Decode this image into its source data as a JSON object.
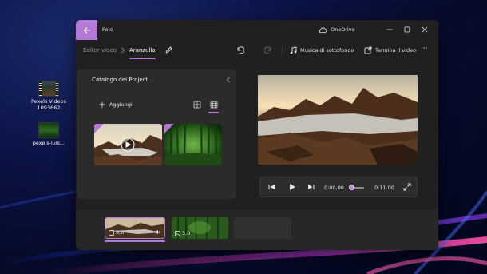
{
  "desktop": {
    "icons": [
      {
        "label_line1": "Pexels Videos",
        "label_line2": "1093662"
      },
      {
        "label_line1": "pexels-luis...",
        "label_line2": ""
      }
    ]
  },
  "window": {
    "app_title": "Foto",
    "cloud_label": "OneDrive",
    "back_icon": "back-arrow-icon"
  },
  "toolbar": {
    "breadcrumb_parent": "Editor video",
    "breadcrumb_current": "Aranzulla",
    "music_label": "Musica di sottofondo",
    "finish_label": "Termina il video",
    "more_label": "···"
  },
  "project_library": {
    "title": "Catalogo del Project",
    "add_label": "Aggiungi"
  },
  "player": {
    "current_time": "0:00,00",
    "total_time": "0:11,00",
    "progress_fraction": 0.0
  },
  "storyboard": {
    "clips": [
      {
        "duration": "8,0",
        "selected": true
      },
      {
        "duration": "3,0",
        "selected": false
      }
    ]
  },
  "colors": {
    "accent": "#b479d6",
    "window_bg": "#202020",
    "panel_bg": "#2b2b2b"
  }
}
